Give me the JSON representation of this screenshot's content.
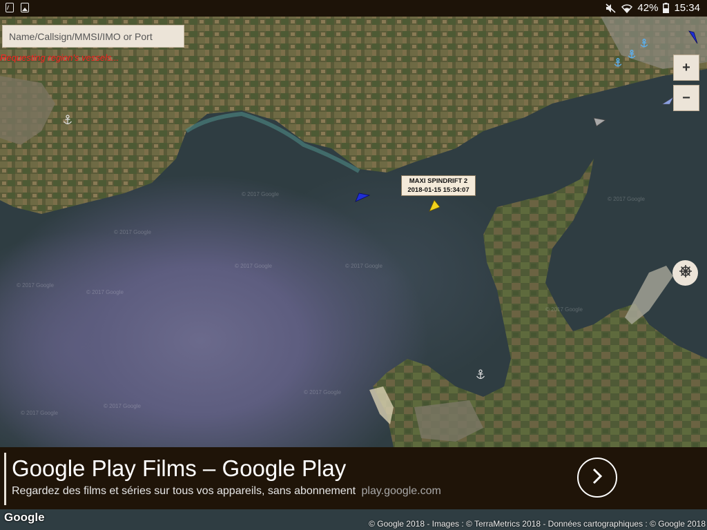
{
  "status_bar": {
    "battery": "42%",
    "time": "15:34",
    "left_icons": [
      "document-notification-icon",
      "image-notification-icon"
    ],
    "right_icons": [
      "mute-icon",
      "wifi-icon",
      "battery-icon"
    ]
  },
  "search": {
    "placeholder": "Name/Callsign/MMSI/IMO or Port"
  },
  "status_message": "Requesting region's vessels...",
  "map_controls": {
    "zoom_in": "+",
    "zoom_out": "−",
    "compass_icon": "ship-wheel-icon"
  },
  "vessel_label": {
    "name": "MAXI SPINDRIFT 2",
    "timestamp": "2018-01-15 15:34:07"
  },
  "watermarks": [
    "© 2017 Google"
  ],
  "ad": {
    "title": "Google Play Films – Google Play",
    "subtitle": "Regardez des films et séries sur tous vos appareils, sans abonnement",
    "url": "play.google.com",
    "arrow_icon": "chevron-right-icon"
  },
  "footer": {
    "logo": "Google",
    "attribution": "© Google 2018 - Images : © TerraMetrics 2018 - Données cartographiques : © Google 2018"
  },
  "colors": {
    "status_bar_bg": "#1d1308",
    "control_bg": "#ece4d8",
    "status_message": "#ff2020",
    "selected_vessel": "#f2d21b",
    "vessel_blue": "#1f2fd6",
    "vessel_grey": "#a9a9a9",
    "ad_bg": "#1f1408"
  }
}
